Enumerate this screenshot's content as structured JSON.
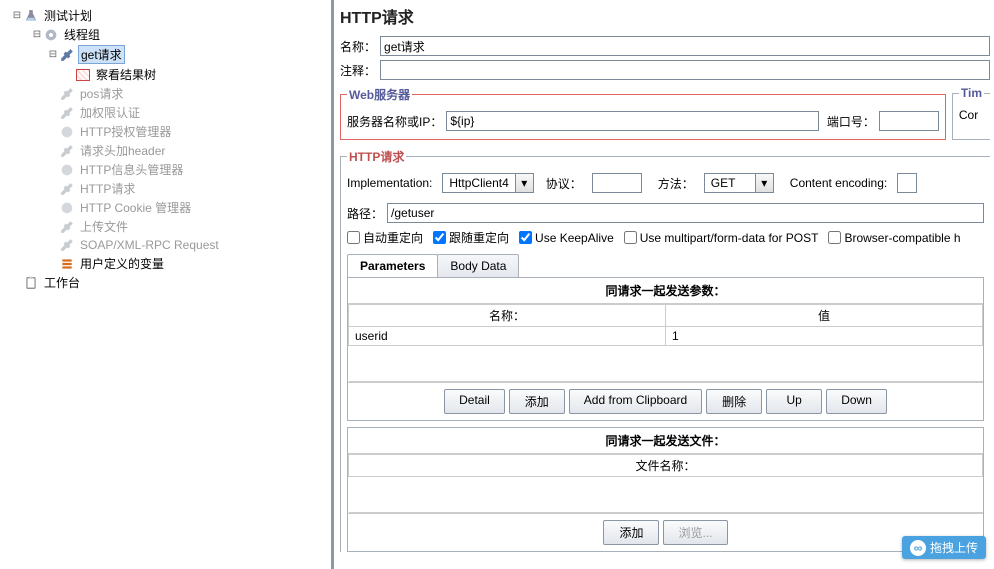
{
  "tree": {
    "testPlan": "测试计划",
    "threadGroup": "线程组",
    "getRequest": "get请求",
    "viewResults": "察看结果树",
    "posRequest": "pos请求",
    "authWeighted": "加权限认证",
    "httpAuthMgr": "HTTP授权管理器",
    "headerAdd": "请求头加header",
    "httpHeaderMgr": "HTTP信息头管理器",
    "httpRequest": "HTTP请求",
    "httpCookie": "HTTP Cookie 管理器",
    "upload": "上传文件",
    "soapXml": "SOAP/XML-RPC Request",
    "userVars": "用户定义的变量",
    "workbench": "工作台"
  },
  "panel": {
    "title": "HTTP请求",
    "nameLabel": "名称：",
    "nameValue": "get请求",
    "commentLabel": "注释：",
    "commentValue": ""
  },
  "webServer": {
    "legend": "Web服务器",
    "serverLabel": "服务器名称或IP：",
    "serverValue": "${ip}",
    "portLabel": "端口号：",
    "portValue": ""
  },
  "timeout": {
    "legend": "Tim",
    "connect": "Cor"
  },
  "httpReq": {
    "legend": "HTTP请求",
    "implLabel": "Implementation:",
    "implValue": "HttpClient4",
    "protoLabel": "协议：",
    "protoValue": "",
    "methodLabel": "方法：",
    "methodValue": "GET",
    "encLabel": "Content encoding:",
    "encValue": "",
    "pathLabel": "路径：",
    "pathValue": "/getuser"
  },
  "opts": {
    "autoRedirect": "自动重定向",
    "followRedirect": "跟随重定向",
    "keepAlive": "Use KeepAlive",
    "multipart": "Use multipart/form-data for POST",
    "browserCompat": "Browser-compatible h"
  },
  "tabs": {
    "params": "Parameters",
    "body": "Body Data"
  },
  "paramsSection": {
    "header": "同请求一起发送参数：",
    "colName": "名称：",
    "colValue": "值",
    "rows": [
      {
        "name": "userid",
        "value": "1"
      }
    ],
    "btn": {
      "detail": "Detail",
      "add": "添加",
      "clip": "Add from Clipboard",
      "delete": "删除",
      "up": "Up",
      "down": "Down"
    }
  },
  "filesSection": {
    "header": "同请求一起发送文件：",
    "colFile": "文件名称：",
    "btn": {
      "add": "添加",
      "browse": "浏览..."
    }
  },
  "floatTag": "拖拽上传"
}
